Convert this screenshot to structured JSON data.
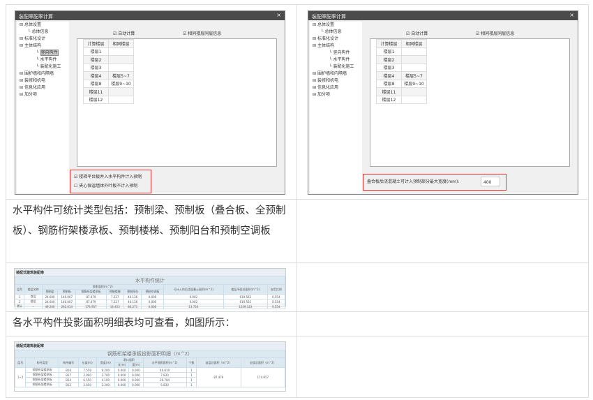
{
  "dialog": {
    "title": "装配率配率计算",
    "close": "×",
    "tree": [
      "总体设置",
      "总体信息",
      "标准化设计",
      "主体结构",
      "竖向构件",
      "水平构件",
      "装配化施工",
      "围护墙和内隔墙",
      "装修和机电",
      "信息化应用",
      "加分项"
    ],
    "auto_calc": "自动计算",
    "same_floor": "相同楼层同层信息",
    "floor_headers": [
      "计算楼层",
      "相同楼层"
    ],
    "floors": [
      [
        "楼层1",
        ""
      ],
      [
        "楼层2",
        ""
      ],
      [
        "楼层3",
        ""
      ],
      [
        "楼层4",
        "楼层5~7"
      ],
      [
        "楼层8",
        "楼层9~10"
      ],
      [
        "楼层11",
        ""
      ],
      [
        "楼层12",
        ""
      ]
    ],
    "left_opt1": "楼梯平台板并入水平构件计入预制",
    "left_opt2": "夹心保温墙体外叶板不计入预制",
    "right_opt": "叠合板后浇混凝土可计入预制部分最大宽度(mm):",
    "right_value": "400"
  },
  "para1": "水平构件可统计类型包括：预制梁、预制板（叠合板、全预制板）、钢筋桁架楼承板、预制楼梯、预制阳台和预制空调板",
  "para2": "各水平构件投影面积明细表均可查看，如图所示：",
  "report1": {
    "header": "装配式建筑装配率",
    "title": "水平构件统计",
    "cols": [
      "层号",
      "楼层名称",
      "预制梁",
      "预制板",
      "钢筋桁架楼承板",
      "预制楼梯",
      "预制阳台",
      "预制空调板",
      "可计入的后浇混凝土面积(m^2)",
      "楼层平面总面积(m^2)",
      "应用比例"
    ],
    "group": "投影面积(m^2)",
    "rows": [
      [
        "1",
        "首层",
        "24.600",
        "146.007",
        "87.479",
        "7.227",
        "40.136",
        "0.000",
        "0.002",
        "619.562",
        "0.554"
      ],
      [
        "2",
        "楼层",
        "24.600",
        "146.007",
        "87.479",
        "7.227",
        "40.136",
        "0.000",
        "0.002",
        "619.562",
        "0.554"
      ],
      [
        "累计",
        "--",
        "49.200",
        "292.014",
        "174.957",
        "14.453",
        "80.271",
        "0.000",
        "13.724",
        "1239.123",
        "0.554"
      ]
    ]
  },
  "report2": {
    "header": "装配式建筑装配率",
    "title": "钢筋桁架楼承板投影面积明细（m^2）",
    "cols": [
      "层号",
      "构件类型",
      "构件编号",
      "长度(m)",
      "宽度(m)",
      "洞口面积",
      "长(m)",
      "宽(m)",
      "水平投影面积(m^2)",
      "个数",
      "该层总面积（m^2）",
      "全楼总面积（m^2）"
    ],
    "floor": "1~2",
    "rows": [
      [
        "钢筋桁架楼承板",
        "B16",
        "7.559",
        "6.200",
        "0.000",
        "0.000",
        "46.819",
        "1"
      ],
      [
        "钢筋桁架楼承板",
        "B17",
        "2.900",
        "2.700",
        "0.000",
        "0.000",
        "7.830",
        "1"
      ],
      [
        "钢筋桁架楼承板",
        "B14",
        "6.550",
        "4.100",
        "0.000",
        "0.000",
        "26.784",
        "1"
      ],
      [
        "钢筋桁架楼承板",
        "B13",
        "2.650",
        "2.200",
        "0.000",
        "0.000",
        "5.830",
        "1"
      ]
    ],
    "floor_total": "87.479",
    "all_total": "174.957"
  }
}
